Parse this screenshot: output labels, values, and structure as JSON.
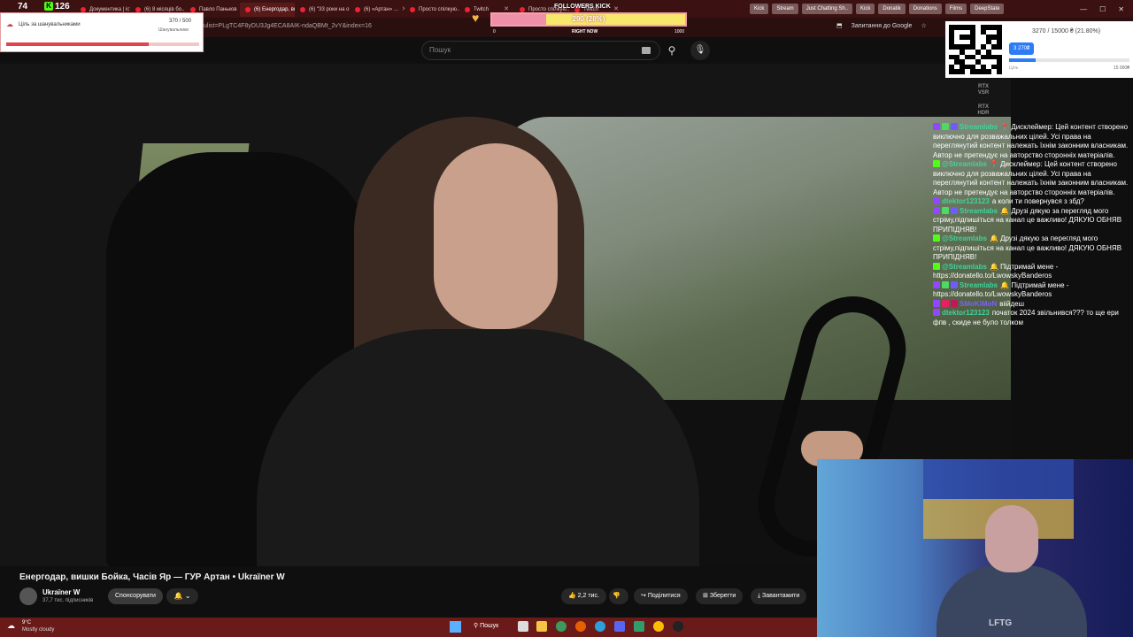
{
  "browser": {
    "tabs": [
      {
        "label": "Документика | історія"
      },
      {
        "label": "(6) 8 місяців бо..."
      },
      {
        "label": "Павло Паньков"
      },
      {
        "label": "(6) Енергодар, ви...",
        "active": true
      },
      {
        "label": "(6) \"33 роки на о..."
      },
      {
        "label": "(6) «Артан» ..."
      },
      {
        "label": "Просто спілкую..."
      },
      {
        "label": "Twitch"
      },
      {
        "label": "Просто спілкую..."
      },
      {
        "label": "Twitch"
      }
    ],
    "bookmarks": [
      "Kick",
      "Stream",
      "Just Chatting Sh..",
      "Kick",
      "Donatik",
      "Donations",
      "Films",
      "DeepState"
    ],
    "url": "ulist=PLgTC4F8yDU3Jg4ECA8AIK-ndaQBMt_2vY&index=16",
    "right_button": "Запитання до Google"
  },
  "youtube": {
    "premium_label": "Premium",
    "search_placeholder": "Пошук",
    "video_title": "Енергодар, вишки Бойка, Часів Яр — ГУР Артан • Ukraїner W",
    "channel_name": "Ukraїner W",
    "channel_subs": "37,7 тис. підписників",
    "sponsor_label": "Спонсорувати",
    "like_label": "2,2 тис.",
    "share_label": "Поділитися",
    "save_label": "Зберегти",
    "download_label": "Завантажити"
  },
  "overlays": {
    "top_counter_a": "74",
    "top_counter_b": "126",
    "follower_goal": {
      "title": "Ціль за шанувальниками",
      "count": "370 / 500",
      "sub_label": "Шанувальники",
      "progress": 0.74
    },
    "followers_kick": {
      "title": "FOLLOWERS KICK",
      "value": "290 (28%)",
      "progress": 0.28,
      "min": "0",
      "now": "RIGHT NOW",
      "max": "1000"
    },
    "donation": {
      "progress_text": "3270 / 15000 ₴ (21.80%)",
      "pill": "3 270₴",
      "min_label": "Ціль",
      "max_label": "15 000₴",
      "progress": 0.218
    },
    "rtx": [
      "RTX VSR",
      "RTX HDR"
    ]
  },
  "chat": [
    {
      "user": "Streamlabs",
      "color": "#3fd49c",
      "badges": [
        "#9147ff",
        "#4cd964",
        "#6e5cff"
      ],
      "text": "📍 Дисклеймер: Цей контент створено виключно для розважальних цілей. Усі права на переглянутий контент належать їхнім законним власникам. Автор не претендує на авторство сторонніх матеріалів."
    },
    {
      "user": "@Streamlabs",
      "color": "#3fd49c",
      "badges": [
        "#53fc18"
      ],
      "text": "📍 Дисклеймер: Цей контент створено виключно для розважальних цілей. Усі права на переглянутий контент належать їхнім законним власникам. Автор не претендує на авторство сторонніх матеріалів."
    },
    {
      "user": "dtektor123123",
      "color": "#3fd49c",
      "badges": [
        "#9147ff"
      ],
      "text": "а коли ти повернувся з збд?"
    },
    {
      "user": "Streamlabs",
      "color": "#3fd49c",
      "badges": [
        "#9147ff",
        "#4cd964",
        "#6e5cff"
      ],
      "text": "🔔 Друзі дякую за перегляд мого стріму,підпишіться на канал це важливо! ДЯКУЮ ОБНЯВ ПРИПІДНЯВ!"
    },
    {
      "user": "@Streamlabs",
      "color": "#3fd49c",
      "badges": [
        "#53fc18"
      ],
      "text": "🔔 Друзі дякую за перегляд мого стріму,підпишіться на канал це важливо! ДЯКУЮ ОБНЯВ ПРИПІДНЯВ!"
    },
    {
      "user": "@Streamlabs",
      "color": "#3fd49c",
      "badges": [
        "#53fc18"
      ],
      "text": "🔔 Підтримай мене - https://donatello.to/LwowskyBanderos"
    },
    {
      "user": "Streamlabs",
      "color": "#3fd49c",
      "badges": [
        "#9147ff",
        "#4cd964",
        "#6e5cff"
      ],
      "text": "🔔 Підтримай мене - https://donatello.to/LwowskyBanderos"
    },
    {
      "user": "SMoKiMoN",
      "color": "#7b61ff",
      "badges": [
        "#9147ff",
        "#e91e63",
        "#c2185b"
      ],
      "text": "віійдеш"
    },
    {
      "user": "dtektor123123",
      "color": "#3fd49c",
      "badges": [
        "#9147ff"
      ],
      "text": "початок 2024 звільнився??? то ще ери фпв , скиде не було толком"
    }
  ],
  "taskbar": {
    "weather_temp": "9°C",
    "weather_desc": "Mostly cloudy",
    "search_label": "Пошук"
  },
  "webcam": {
    "shirt_text": "LFTG"
  }
}
